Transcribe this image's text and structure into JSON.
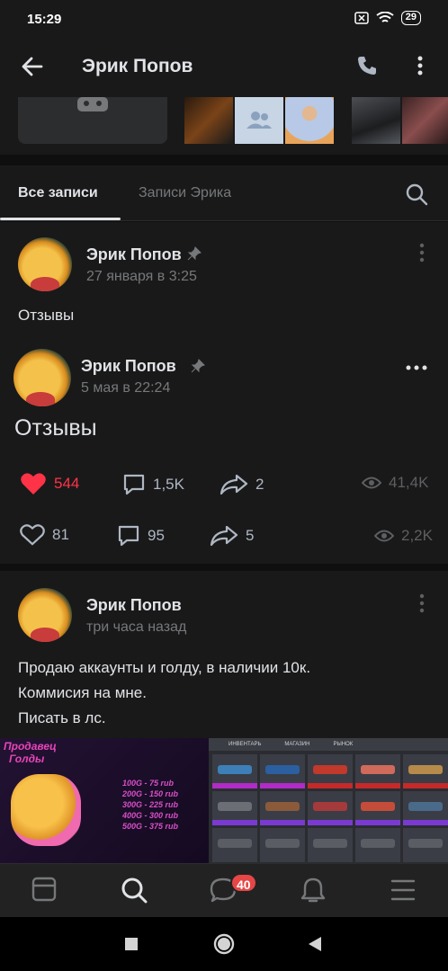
{
  "status_bar": {
    "time": "15:29",
    "battery": "29"
  },
  "header": {
    "title": "Эрик Попов",
    "back_icon": "arrow-left-icon",
    "call_icon": "phone-icon",
    "menu_icon": "more-vertical-icon"
  },
  "tabs": [
    {
      "label": "Все записи",
      "active": true
    },
    {
      "label": "Записи Эрика",
      "active": false
    }
  ],
  "pinned_post": {
    "author": "Эрик Попов",
    "date": "27 января в 3:25",
    "text": "Отзывы",
    "reposted": {
      "author": "Эрик Попов",
      "date": "5 мая в 22:24",
      "text": "Отзывы",
      "stats": {
        "likes": "544",
        "comments": "1,5K",
        "shares": "2",
        "views": "41,4K"
      }
    },
    "stats": {
      "likes": "81",
      "comments": "95",
      "shares": "5",
      "views": "2,2K"
    }
  },
  "post2": {
    "author": "Эрик Попов",
    "date": "три часа назад",
    "lines": [
      "Продаю аккаунты и голду, в наличии 10к.",
      "Коммисия на мне.",
      "Писать в лс."
    ],
    "banner": {
      "seller": [
        "Продавец",
        "Голды"
      ],
      "prices": [
        "100G - 75 rub",
        "200G - 150 rub",
        "300G - 225 rub",
        "400G - 300 rub",
        "500G - 375 rub"
      ],
      "inventory_tabs": [
        "ИНВЕНТАРЬ",
        "МАГАЗИН",
        "РЫНОК"
      ]
    }
  },
  "bottom_nav": {
    "messages_badge": "40"
  },
  "colors": {
    "background": "#19191a",
    "like": "#ff3347",
    "accent": "#e1e3e6",
    "muted": "#76787a"
  }
}
